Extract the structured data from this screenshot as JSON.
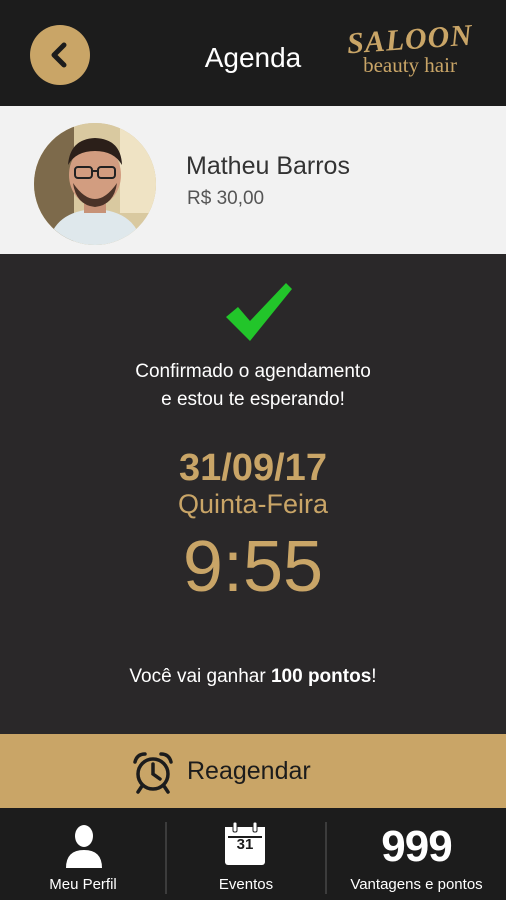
{
  "header": {
    "title": "Agenda",
    "logo_top": "SALOON",
    "logo_bottom": "beauty hair",
    "back_icon": "chevron-left-icon"
  },
  "profile": {
    "name": "Matheu Barros",
    "price": "R$ 30,00"
  },
  "confirmation": {
    "line1": "Confirmado o agendamento",
    "line2": "e estou te esperando!",
    "date": "31/09/17",
    "weekday": "Quinta-Feira",
    "time": "9:55",
    "points_prefix": "Você vai ganhar ",
    "points_value": "100 pontos",
    "points_suffix": "!"
  },
  "reschedule": {
    "label": "Reagendar",
    "icon": "alarm-clock-icon"
  },
  "tabs": [
    {
      "label": "Meu Perfil",
      "icon": "user-icon"
    },
    {
      "label": "Eventos",
      "icon": "calendar-icon",
      "icon_text": "31"
    },
    {
      "label": "Vantagens e pontos",
      "value": "999"
    }
  ],
  "colors": {
    "accent": "#c9a567",
    "header_bg": "#1c1c1c",
    "body_bg": "#2a2829",
    "profile_bg": "#f2f2f2",
    "check": "#22c52a"
  }
}
